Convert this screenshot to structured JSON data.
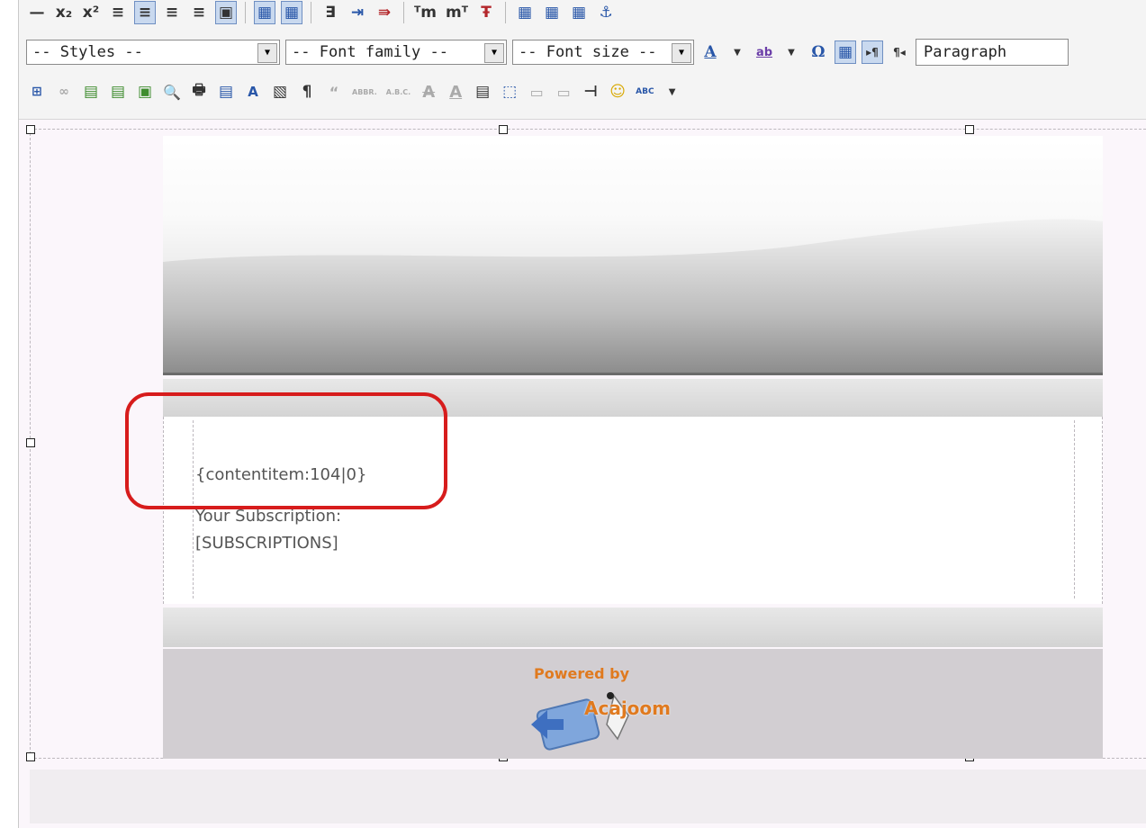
{
  "toolbar": {
    "styles_select": "-- Styles --",
    "font_family_select": "-- Font family --",
    "font_size_select": "-- Font size --",
    "format_select": "Paragraph",
    "row1_glyphs": [
      "—",
      "x₂",
      "x²",
      "≡",
      "≡",
      "≡",
      "≡",
      "▣",
      "▦",
      "▦",
      "∃",
      "⇥",
      "⇛",
      "ᵀm",
      "mᵀ",
      "Ŧ",
      "▦",
      "▦",
      "▦",
      "⚓"
    ],
    "row2_glyphs": [
      "A",
      "ab",
      "Ω",
      "▦",
      "▸¶",
      "¶◂"
    ],
    "row3_glyphs": [
      "⊞",
      "∞",
      "▤",
      "▤",
      "▣",
      "🔍",
      "🖶",
      "▤",
      "A",
      "▧",
      "¶",
      "“",
      "ABBR.",
      "A.B.C.",
      "A",
      "A",
      "▤",
      "⬚",
      "▭",
      "▭",
      "⊣",
      "☺",
      "ABC"
    ]
  },
  "editor": {
    "content_item": "{contentitem:104|0}",
    "subscription_label": "Your Subscription:",
    "subscriptions_tag": "[SUBSCRIPTIONS]",
    "powered_by": "Powered by",
    "logo_text": "Acajoom"
  },
  "colors": {
    "highlight_circle": "#d71c1c",
    "logo_orange": "#e07a1f"
  }
}
